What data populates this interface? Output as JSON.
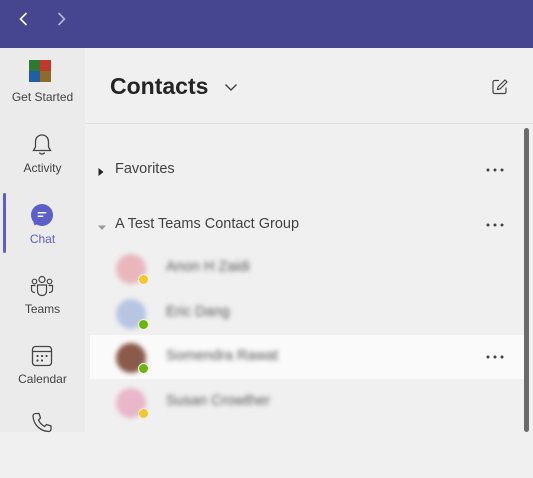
{
  "nav": {
    "back_icon": "chevron-left-icon",
    "forward_icon": "chevron-right-icon"
  },
  "app_rail": [
    {
      "label": "Get Started",
      "icon": "get-started-icon"
    },
    {
      "label": "Activity",
      "icon": "bell-icon"
    },
    {
      "label": "Chat",
      "icon": "chat-icon",
      "active": true
    },
    {
      "label": "Teams",
      "icon": "teams-icon"
    },
    {
      "label": "Calendar",
      "icon": "calendar-icon"
    },
    {
      "label": "",
      "icon": "phone-icon"
    }
  ],
  "panel": {
    "title": "Contacts",
    "compose_icon": "compose-icon",
    "groups": [
      {
        "title": "Favorites",
        "expanded": false
      },
      {
        "title": "A Test Teams Contact Group",
        "expanded": true
      }
    ],
    "contacts": [
      {
        "name": "Anon H Zaidi",
        "presence_color": "#f8c629",
        "avatar_color": "#e9b7bb"
      },
      {
        "name": "Eric Dang",
        "presence_color": "#6bb700",
        "avatar_color": "#b7c5e3"
      },
      {
        "name": "Somendra Rawat",
        "presence_color": "#6bb700",
        "avatar_color": "#8a5a4a",
        "hovered": true
      },
      {
        "name": "Susan Crowther",
        "presence_color": "#f8c629",
        "avatar_color": "#eab6c9"
      }
    ]
  },
  "colors": {
    "accent": "#5b5fc7",
    "titlebar": "#46458f"
  }
}
